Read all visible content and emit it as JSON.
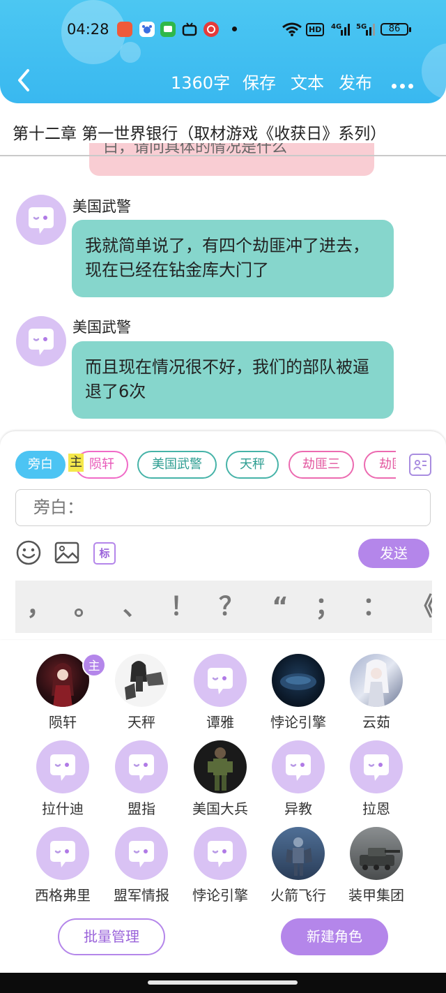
{
  "status_bar": {
    "time": "04:28",
    "network_hd": "HD",
    "signal_4g": "4G",
    "signal_5g": "5G",
    "battery": "86"
  },
  "header": {
    "word_count": "1360字",
    "save": "保存",
    "text": "文本",
    "publish": "发布",
    "back_icon": "chevron-left-icon",
    "more_icon": "more-dots-icon"
  },
  "chapter": {
    "title": "第十二章 第一世界银行（取材游戏《收获日》系列）"
  },
  "chat": {
    "cut_off_text": "白，请问具体的情况是什么",
    "messages": [
      {
        "sender": "美国武警",
        "text": "我就简单说了，有四个劫匪冲了进去，现在已经在钻金库大门了"
      },
      {
        "sender": "美国武警",
        "text": "而且现在情况很不好，我们的部队被逼退了6次"
      }
    ]
  },
  "composer": {
    "chips": [
      "旁白",
      "陨轩",
      "美国武警",
      "天秤",
      "劫匪三",
      "劫匪"
    ],
    "main_tag": "主",
    "input_placeholder": "旁白：",
    "mark_label": "标",
    "send": "发送",
    "punctuation": [
      "，",
      "。",
      "、",
      "！",
      "？",
      "“",
      "；",
      "：",
      "《"
    ]
  },
  "characters": {
    "main_badge": "主",
    "items": [
      {
        "name": "陨轩",
        "avatar": "anime-girl-red"
      },
      {
        "name": "天秤",
        "avatar": "anime-mecha-girl"
      },
      {
        "name": "谭雅",
        "avatar": "default"
      },
      {
        "name": "悖论引擎",
        "avatar": "dark-sphere"
      },
      {
        "name": "云茹",
        "avatar": "anime-white-hair"
      },
      {
        "name": "拉什迪",
        "avatar": "default"
      },
      {
        "name": "盟指",
        "avatar": "default"
      },
      {
        "name": "美国大兵",
        "avatar": "soldier"
      },
      {
        "name": "异教",
        "avatar": "default"
      },
      {
        "name": "拉恩",
        "avatar": "default"
      },
      {
        "name": "西格弗里",
        "avatar": "default"
      },
      {
        "name": "盟军情报",
        "avatar": "default"
      },
      {
        "name": "悖论引擎",
        "avatar": "default"
      },
      {
        "name": "火箭飞行",
        "avatar": "rocket-trooper"
      },
      {
        "name": "装甲集团",
        "avatar": "tank"
      }
    ]
  },
  "actions": {
    "batch_manage": "批量管理",
    "new_role": "新建角色"
  },
  "colors": {
    "header_blue": "#39b8f0",
    "message_teal": "#86d6cc",
    "accent_purple": "#b486ea",
    "avatar_lavender": "#d9c2f4"
  }
}
